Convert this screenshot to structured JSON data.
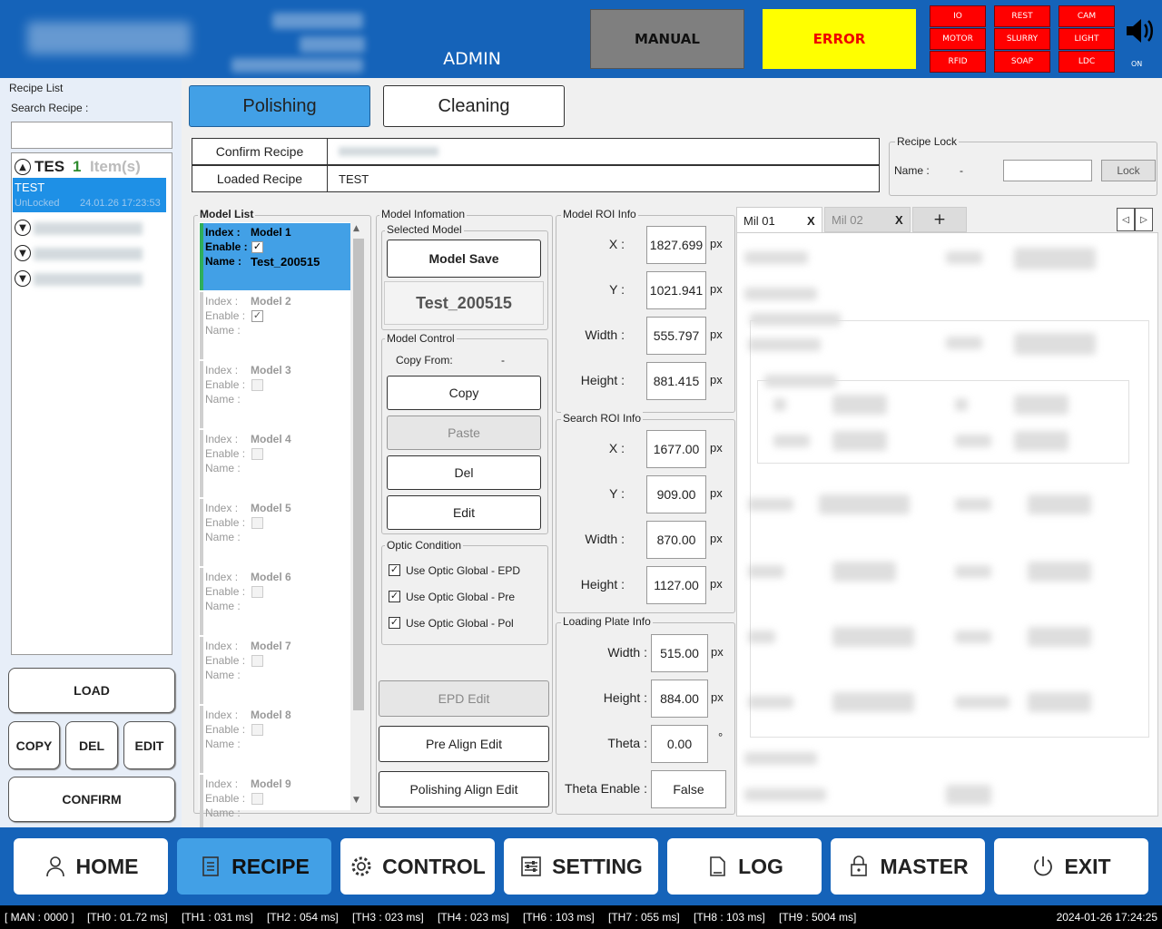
{
  "header": {
    "user_role": "ADMIN",
    "mode": "MANUAL",
    "alarm": "ERROR",
    "status_buttons": [
      "IO",
      "REST",
      "CAM",
      "MOTOR",
      "SLURRY",
      "LIGHT",
      "RFID",
      "SOAP",
      "LDC"
    ],
    "sound_label": "ON"
  },
  "recipe_panel": {
    "title": "Recipe List",
    "search_label": "Search Recipe :",
    "search_value": "",
    "group_name": "TES",
    "group_count": "1",
    "group_count_suffix": "Item(s)",
    "selected_recipe": {
      "name": "TEST",
      "lock_state": "UnLocked",
      "timestamp": "24.01.26 17:23:53"
    },
    "buttons": {
      "load": "LOAD",
      "copy": "COPY",
      "del": "DEL",
      "edit": "EDIT",
      "confirm": "CONFIRM"
    }
  },
  "process_tabs": {
    "polishing": "Polishing",
    "cleaning": "Cleaning"
  },
  "recipe_info": {
    "confirm_label": "Confirm Recipe",
    "confirm_value": "",
    "loaded_label": "Loaded Recipe",
    "loaded_value": "TEST"
  },
  "recipe_lock": {
    "title": "Recipe Lock",
    "name_label": "Name :",
    "name_value": "-",
    "input_value": "",
    "lock_button": "Lock"
  },
  "model_list": {
    "title": "Model List",
    "index_label": "Index :",
    "enable_label": "Enable :",
    "name_label": "Name :",
    "items": [
      {
        "index": "Model 1",
        "enabled": true,
        "name": "Test_200515"
      },
      {
        "index": "Model 2",
        "enabled": true,
        "name": ""
      },
      {
        "index": "Model 3",
        "enabled": false,
        "name": ""
      },
      {
        "index": "Model 4",
        "enabled": false,
        "name": ""
      },
      {
        "index": "Model 5",
        "enabled": false,
        "name": ""
      },
      {
        "index": "Model 6",
        "enabled": false,
        "name": ""
      },
      {
        "index": "Model 7",
        "enabled": false,
        "name": ""
      },
      {
        "index": "Model 8",
        "enabled": false,
        "name": ""
      },
      {
        "index": "Model 9",
        "enabled": false,
        "name": ""
      }
    ]
  },
  "model_info": {
    "title": "Model Infomation",
    "selected_model_title": "Selected Model",
    "save_button": "Model Save",
    "selected_model_name": "Test_200515",
    "control_title": "Model Control",
    "copy_from_label": "Copy From:",
    "copy_from_value": "-",
    "buttons": {
      "copy": "Copy",
      "paste": "Paste",
      "del": "Del",
      "edit": "Edit"
    },
    "optic_title": "Optic Condition",
    "optic_options": [
      {
        "label": "Use Optic Global - EPD",
        "checked": true
      },
      {
        "label": "Use Optic Global - Pre",
        "checked": true
      },
      {
        "label": "Use Optic Global - Pol",
        "checked": true
      }
    ],
    "epd_edit": "EPD Edit",
    "pre_align_edit": "Pre Align Edit",
    "polishing_align_edit": "Polishing Align Edit"
  },
  "model_roi": {
    "title": "Model ROI Info",
    "fields": [
      {
        "label": "X :",
        "value": "1827.699",
        "unit": "px"
      },
      {
        "label": "Y :",
        "value": "1021.941",
        "unit": "px"
      },
      {
        "label": "Width :",
        "value": "555.797",
        "unit": "px"
      },
      {
        "label": "Height :",
        "value": "881.415",
        "unit": "px"
      }
    ]
  },
  "search_roi": {
    "title": "Search ROI Info",
    "fields": [
      {
        "label": "X :",
        "value": "1677.00",
        "unit": "px"
      },
      {
        "label": "Y :",
        "value": "909.00",
        "unit": "px"
      },
      {
        "label": "Width :",
        "value": "870.00",
        "unit": "px"
      },
      {
        "label": "Height :",
        "value": "1127.00",
        "unit": "px"
      }
    ]
  },
  "loading_plate": {
    "title": "Loading Plate Info",
    "fields": [
      {
        "label": "Width :",
        "value": "515.00",
        "unit": "px"
      },
      {
        "label": "Height :",
        "value": "884.00",
        "unit": "px"
      },
      {
        "label": "Theta :",
        "value": "0.00",
        "unit": "°"
      },
      {
        "label": "Theta Enable :",
        "value": "False",
        "unit": ""
      }
    ]
  },
  "mill_tabs": {
    "tab1": "Mil 01",
    "tab2": "Mil 02",
    "close": "X",
    "add": "+"
  },
  "nav": {
    "home": "HOME",
    "recipe": "RECIPE",
    "control": "CONTROL",
    "setting": "SETTING",
    "log": "LOG",
    "master": "MASTER",
    "exit": "EXIT"
  },
  "status_bar": {
    "items": [
      "[ MAN : 0000 ]",
      "[TH0 : 01.72 ms]",
      "[TH1 : 031 ms]",
      "[TH2 : 054 ms]",
      "[TH3 : 023 ms]",
      "[TH4 : 023 ms]",
      "[TH6 : 103 ms]",
      "[TH7 : 055 ms]",
      "[TH8 : 103 ms]",
      "[TH9 : 5004 ms]"
    ],
    "datetime": "2024-01-26 17:24:25"
  },
  "colors": {
    "header_blue": "#1563b9",
    "active_blue": "#42a0e6",
    "error_yellow": "#ffff00",
    "alarm_red": "#ff0000"
  }
}
